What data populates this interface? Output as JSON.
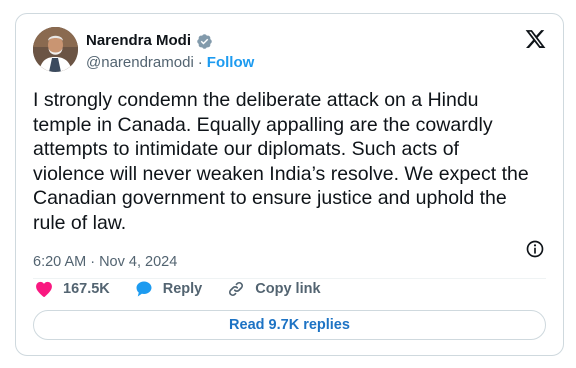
{
  "author": {
    "name": "Narendra Modi",
    "handle": "@narendramodi",
    "separator": "·",
    "follow_label": "Follow",
    "verified_color": "#829aab"
  },
  "tweet": {
    "text": "I strongly condemn the deliberate attack on a Hindu\ntemple in Canada. Equally appalling are the cowardly\nattempts to intimidate our diplomats. Such acts of\nviolence will never weaken India’s resolve. We expect the\nCanadian government to ensure justice and uphold the\nrule of law.",
    "timestamp": "6:20 AM · Nov 4, 2024"
  },
  "actions": {
    "like_count": "167.5K",
    "reply_label": "Reply",
    "copy_link_label": "Copy link",
    "like_color": "#f91880",
    "reply_color": "#1d9bf0"
  },
  "footer": {
    "read_replies_label": "Read 9.7K replies"
  },
  "icons": {
    "logo": "x-logo-icon",
    "verified": "verified-badge-icon",
    "info": "info-icon",
    "like": "heart-icon",
    "reply": "speech-bubble-icon",
    "copy_link": "link-icon"
  }
}
